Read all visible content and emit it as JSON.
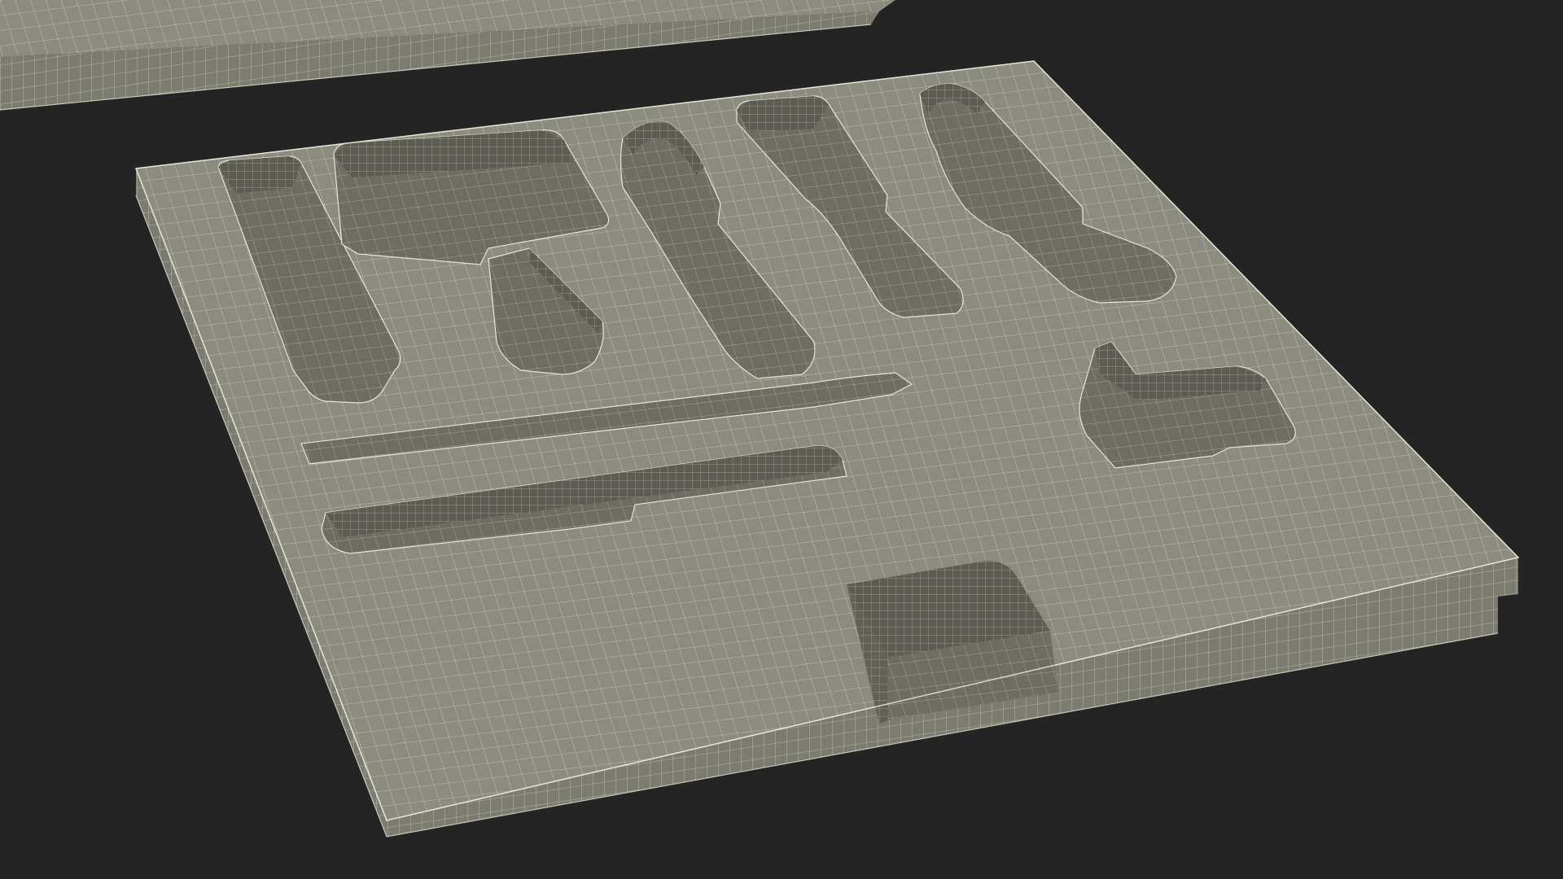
{
  "scene": {
    "background_color": "#242424",
    "surface_color": "#8b8b7f",
    "side_color": "#717167",
    "front_color": "#7b7b70",
    "pocket_floor_color": "#6d6d64",
    "pocket_wall_color": "#5c5c54",
    "wire_color": "#e6e6d4",
    "objects": [
      {
        "name": "foam-tray-insert",
        "description_icon": "wireframe-mesh-icon"
      },
      {
        "name": "tray-lid-edge",
        "description_icon": "wireframe-mesh-icon"
      }
    ]
  }
}
